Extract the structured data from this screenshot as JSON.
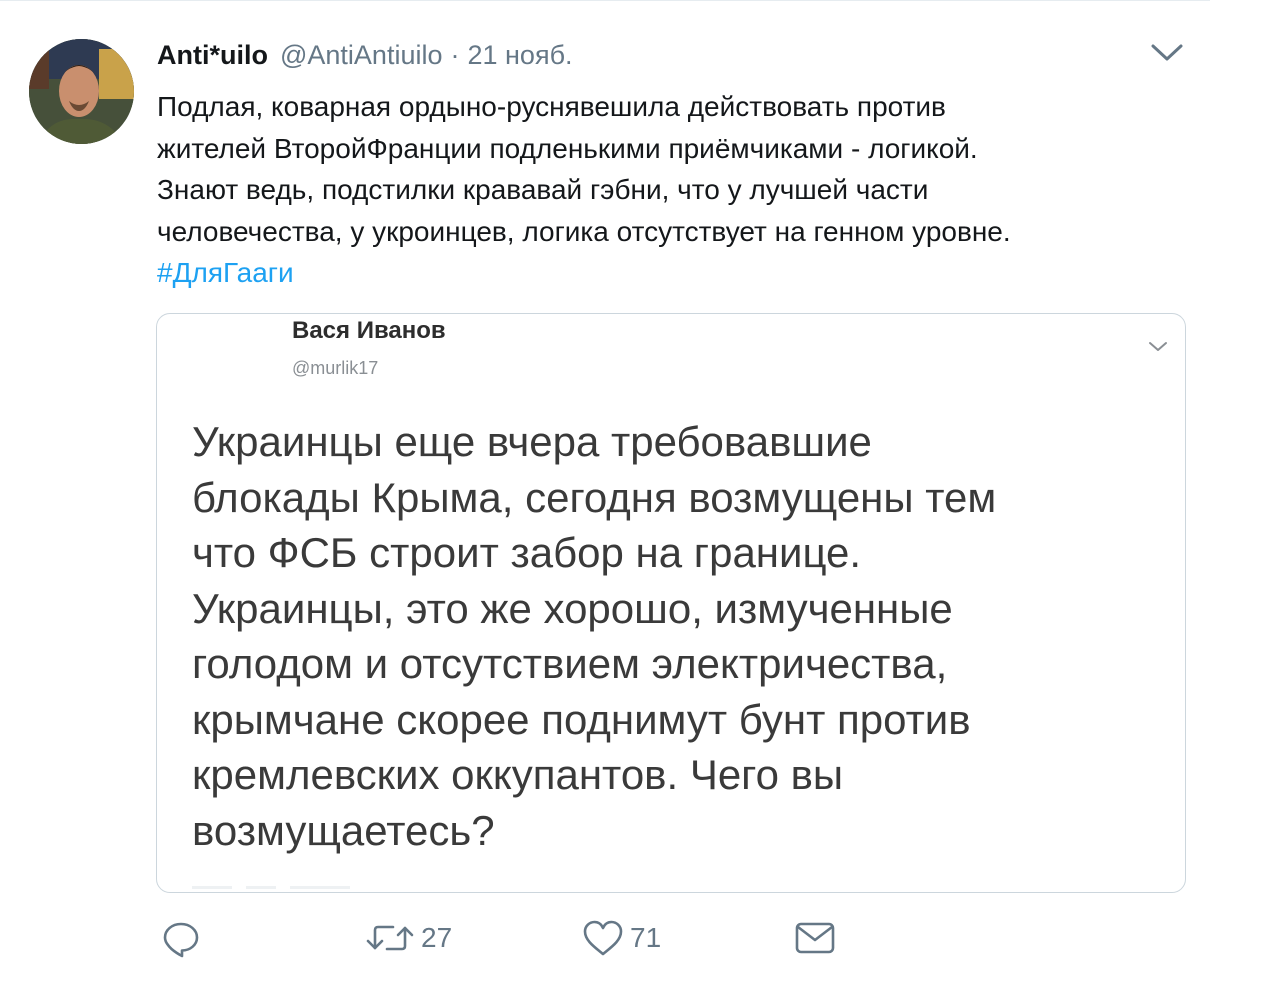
{
  "tweet": {
    "author_name": "Anti*uilo",
    "author_handle": "@AntiAntiuilo",
    "separator": "·",
    "timestamp": "21 нояб.",
    "text_lines": [
      "Подлая, коварная ордыно-руснявешила действовать против",
      "жителей ВторойФранции подленькими приёмчиками - логикой.",
      "Знают ведь, подстилки крававай гэбни, что у лучшей части",
      "человечества, у укроинцев, логика отсутствует на генном уровне."
    ],
    "hashtag": "#ДляГааги"
  },
  "quoted": {
    "name": "Вася Иванов",
    "handle": "@murlik17",
    "text_lines": [
      "Украинцы еще вчера требовавшие",
      "блокады Крыма, сегодня возмущены тем",
      "что ФСБ строит забор на границе.",
      "Украинцы, это же хорошо, измученные",
      "голодом и отсутствием электричества,",
      "крымчане скорее поднимут бунт против",
      "кремлевских оккупантов. Чего вы",
      "возмущаетесь?"
    ]
  },
  "actions": {
    "reply_icon": "reply-icon",
    "retweet_icon": "retweet-icon",
    "retweet_count": "27",
    "like_icon": "heart-icon",
    "like_count": "71",
    "dm_icon": "envelope-icon"
  },
  "colors": {
    "link": "#1da1f2",
    "secondary_text": "#657786",
    "border": "#ccd6dd"
  }
}
